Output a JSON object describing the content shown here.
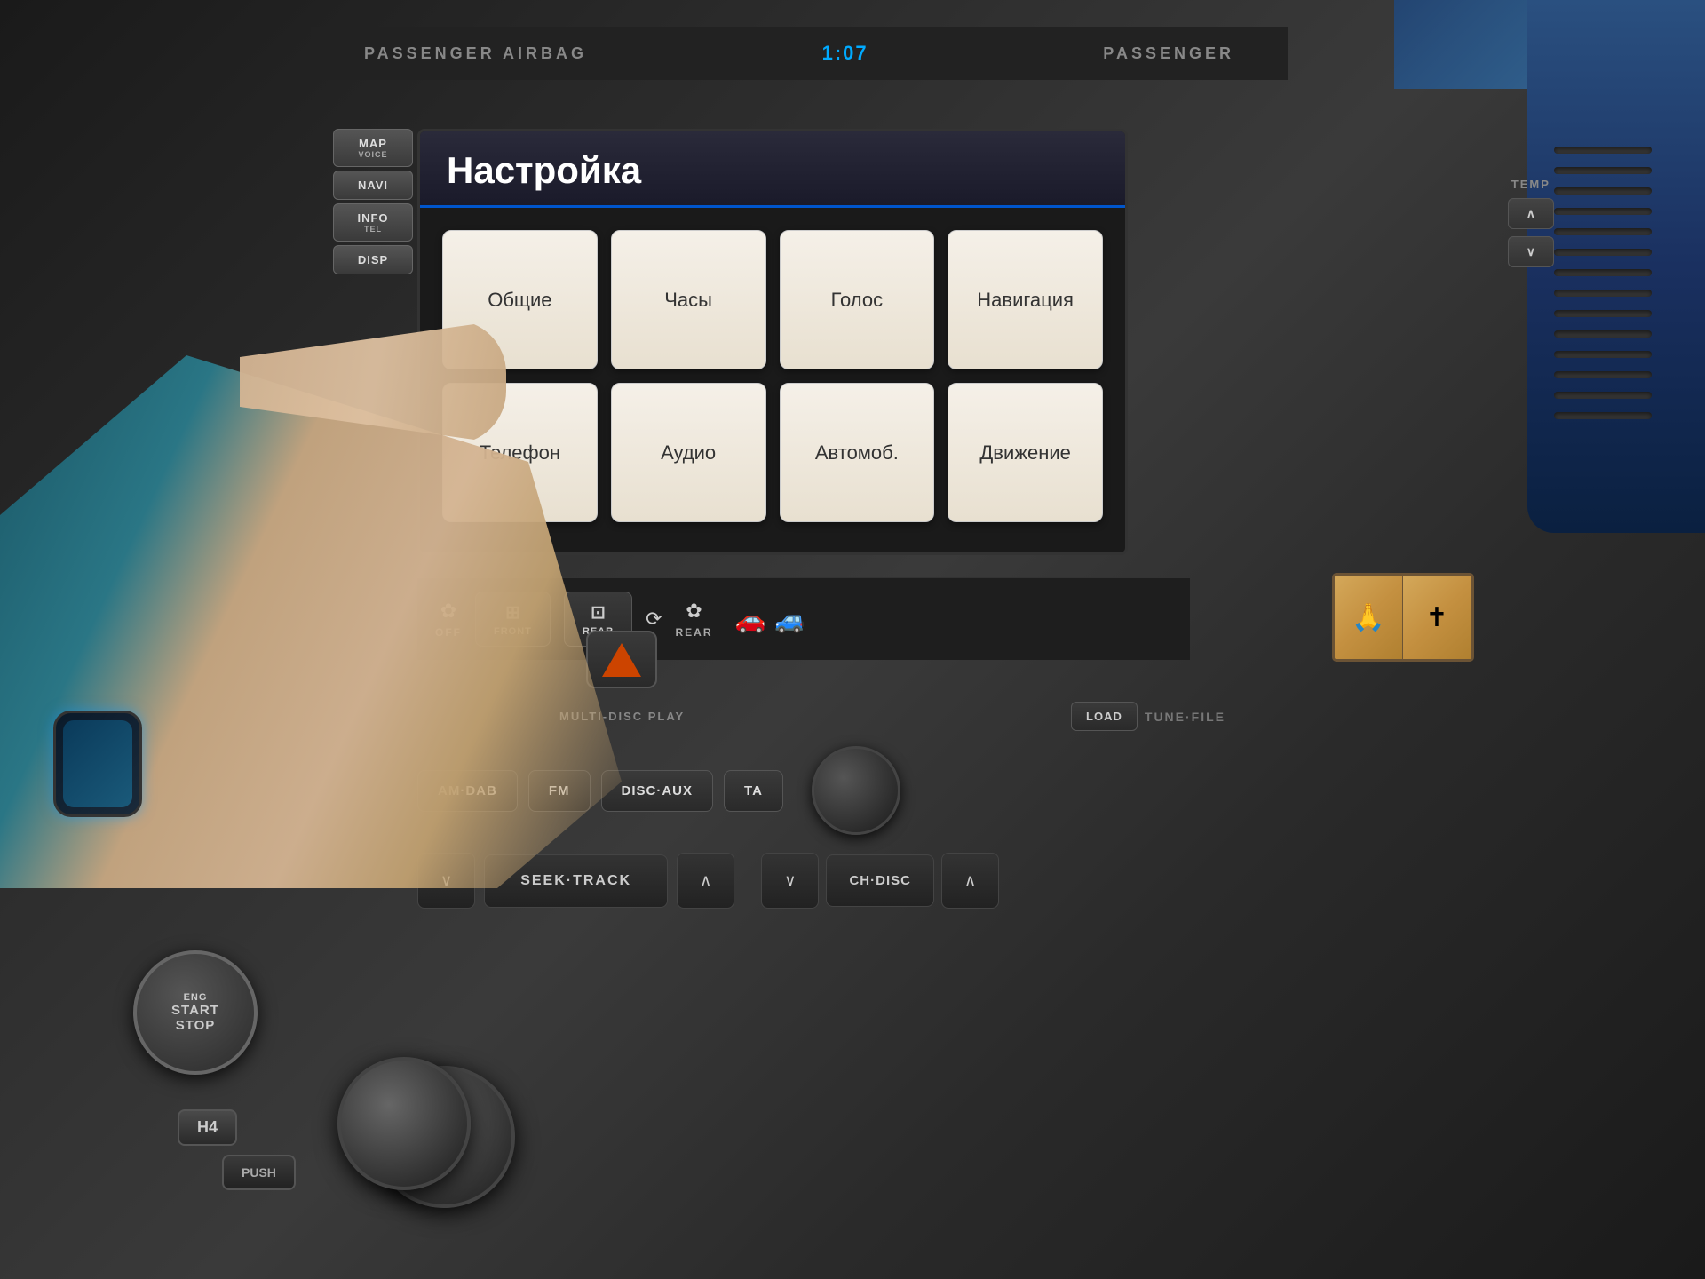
{
  "car": {
    "top_labels": {
      "left": "PASSENGER AIRBAG",
      "right": "PASSENGER"
    },
    "clock": "1:07",
    "nav_buttons": [
      {
        "id": "map-voice",
        "line1": "MAP",
        "line2": "VOICE"
      },
      {
        "id": "navi",
        "line1": "NAVI",
        "line2": ""
      },
      {
        "id": "info-tel",
        "line1": "INFO",
        "line2": "TEL"
      },
      {
        "id": "disp",
        "line1": "DISP",
        "line2": ""
      }
    ],
    "screen": {
      "title": "Настройка",
      "menu_items": [
        {
          "id": "general",
          "label": "Общие"
        },
        {
          "id": "clock",
          "label": "Часы"
        },
        {
          "id": "voice",
          "label": "Голос"
        },
        {
          "id": "navigation",
          "label": "Навигация"
        },
        {
          "id": "phone",
          "label": "Телефон"
        },
        {
          "id": "audio",
          "label": "Аудио"
        },
        {
          "id": "vehicle",
          "label": "Автомоб."
        },
        {
          "id": "traffic",
          "label": "Движение"
        }
      ]
    },
    "ac_controls": [
      {
        "id": "fan-off",
        "icon": "❄",
        "label": "OFF"
      },
      {
        "id": "front",
        "icon": "❐",
        "label": "FRONT"
      },
      {
        "id": "rear",
        "icon": "❐",
        "label": "REAR"
      },
      {
        "id": "recirculate",
        "icon": "↻",
        "label": ""
      },
      {
        "id": "fan-rear",
        "icon": "❄",
        "label": "REAR"
      }
    ],
    "temp_label": "TEMP",
    "temp_up": "∧",
    "temp_down": "∨",
    "audio": {
      "load_label": "LOAD",
      "tune_file_label": "TUNE·FILE",
      "multi_disc_label": "MULTI-DISC PLAY",
      "buttons_row1": [
        {
          "id": "am-dab",
          "label": "AM·DAB"
        },
        {
          "id": "fm",
          "label": "FM"
        },
        {
          "id": "disc-aux",
          "label": "DISC·AUX"
        },
        {
          "id": "ta",
          "label": "TA"
        }
      ],
      "seek_label": "SEEK·TRACK",
      "seek_left": "∨",
      "seek_right": "∧",
      "ch_disc_label": "CH·DISC",
      "ch_left": "∨",
      "ch_right": "∧"
    },
    "ignition": {
      "start_label": "START",
      "stop_label": "STOP",
      "eng_label": "ENG"
    },
    "gear": {
      "h4_label": "H4",
      "push_label": "PUSH"
    }
  }
}
